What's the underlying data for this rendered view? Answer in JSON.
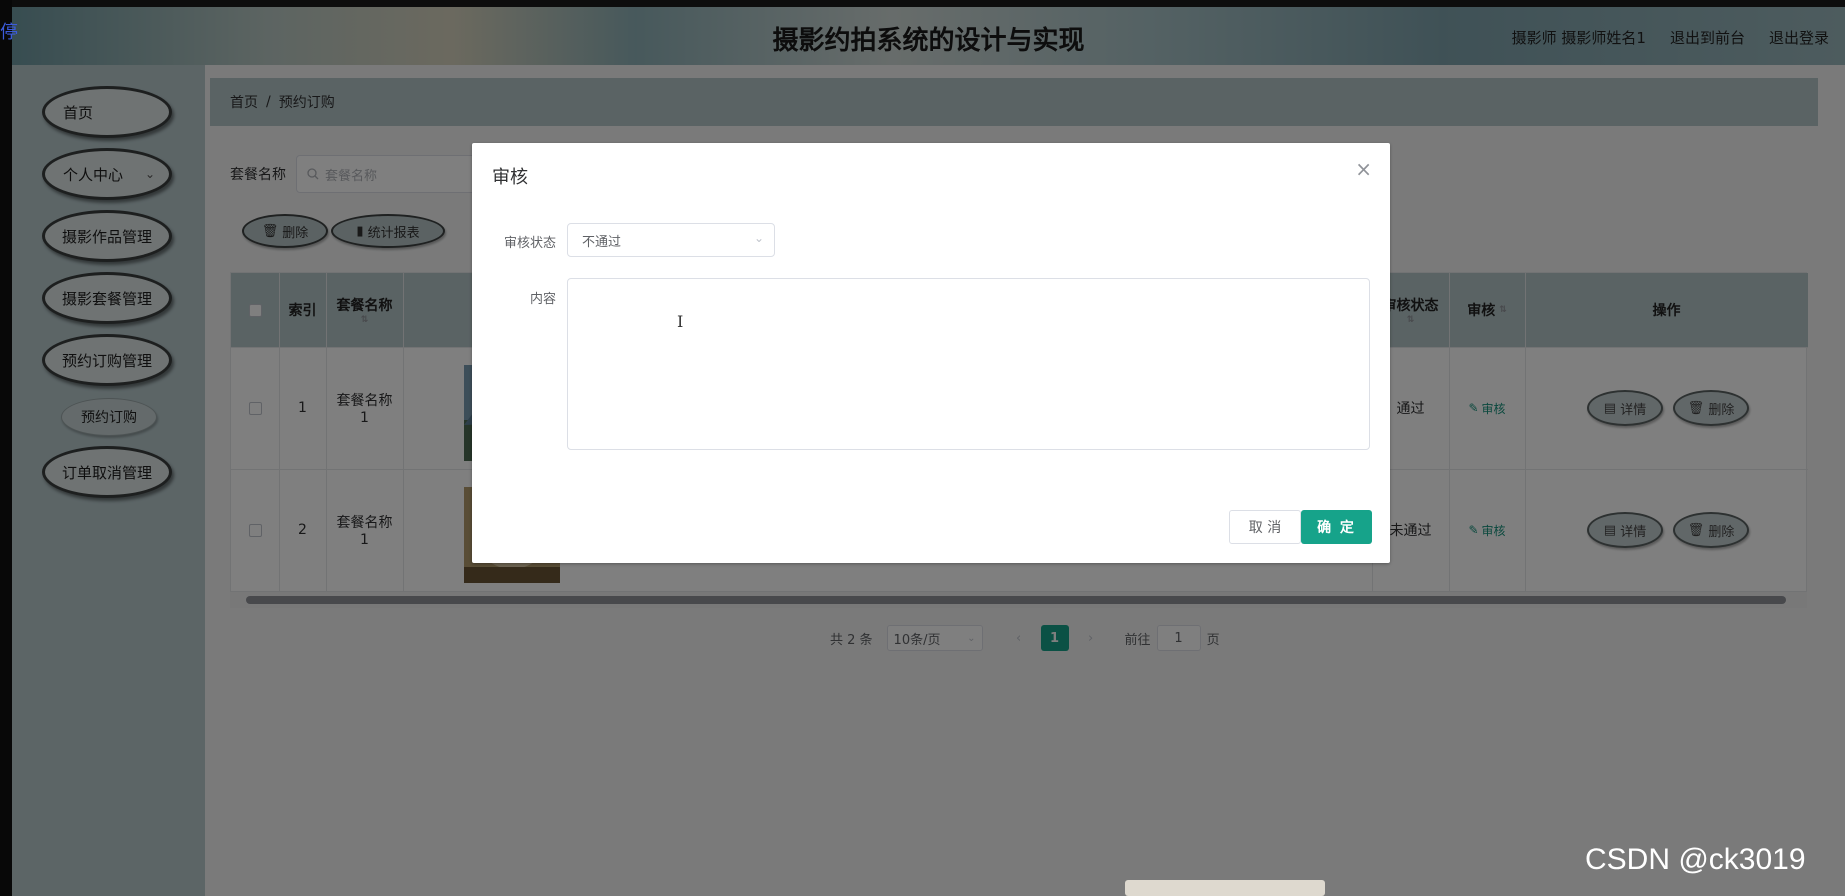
{
  "app": {
    "title": "摄影约拍系统的设计与实现",
    "left_edge_text": "停",
    "user_label": "摄影师 摄影师姓名1",
    "front_label": "退出到前台",
    "logout_label": "退出登录"
  },
  "sidebar": {
    "items": [
      {
        "label": "首页"
      },
      {
        "label": "个人中心"
      },
      {
        "label": "摄影作品管理"
      },
      {
        "label": "摄影套餐管理"
      },
      {
        "label": "预约订购管理"
      },
      {
        "label": "订单取消管理"
      }
    ],
    "sub_item": "预约订购"
  },
  "breadcrumb": {
    "home": "首页",
    "sep": "/",
    "current": "预约订购"
  },
  "filter": {
    "label": "套餐名称",
    "placeholder": "套餐名称"
  },
  "toolbar": {
    "delete_label": "删除",
    "report_label": "统计报表"
  },
  "table": {
    "headers": {
      "index": "索引",
      "package_name": "套餐名称",
      "audit_status": "审核状态",
      "audit": "审核",
      "actions": "操作"
    },
    "rows": [
      {
        "index": "1",
        "package_name": "套餐名称1",
        "audit_status": "通过",
        "audit_link": "审核",
        "detail": "详情",
        "delete": "删除"
      },
      {
        "index": "2",
        "package_name": "套餐名称1",
        "audit_status": "未通过",
        "audit_link": "审核",
        "detail": "详情",
        "delete": "删除"
      }
    ]
  },
  "pagination": {
    "total": "共 2 条",
    "page_size": "10条/页",
    "current_page": "1",
    "goto_label": "前往",
    "goto_value": "1",
    "page_suffix": "页"
  },
  "dialog": {
    "title": "审核",
    "status_label": "审核状态",
    "status_value": "不通过",
    "content_label": "内容",
    "cancel_label": "取 消",
    "ok_label": "确 定"
  },
  "watermark": "CSDN @ck3019",
  "colors": {
    "accent": "#16a38a",
    "header_bg": "#b4c6c8",
    "sidebar_bg": "#b8cacd"
  }
}
